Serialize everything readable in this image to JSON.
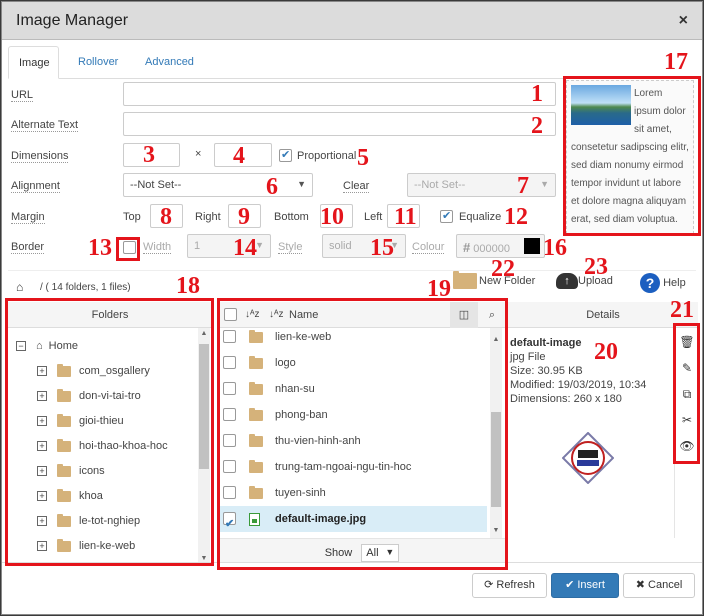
{
  "dialog": {
    "title": "Image Manager",
    "close_icon": "×"
  },
  "tabs": [
    {
      "label": "Image"
    },
    {
      "label": "Rollover"
    },
    {
      "label": "Advanced"
    }
  ],
  "form": {
    "url": {
      "label": "URL",
      "value": ""
    },
    "alt": {
      "label": "Alternate Text",
      "value": ""
    },
    "dimensions": {
      "label": "Dimensions",
      "width": "",
      "height": "",
      "separator": "×",
      "proportional_label": "Proportional",
      "proportional_checked": true
    },
    "alignment": {
      "label": "Alignment",
      "value": "--Not Set--"
    },
    "clear": {
      "label": "Clear",
      "value": "--Not Set--"
    },
    "margin": {
      "label": "Margin",
      "top_label": "Top",
      "right_label": "Right",
      "bottom_label": "Bottom",
      "left_label": "Left",
      "equalize_label": "Equalize",
      "equalize_checked": true
    },
    "border": {
      "label": "Border",
      "enabled": false,
      "width_label": "Width",
      "width_value": "1",
      "style_label": "Style",
      "style_value": "solid",
      "colour_label": "Colour",
      "colour_value": "000000",
      "colour_hash": "#",
      "colour_swatch": "#000000"
    }
  },
  "preview": {
    "text": "Lorem ipsum dolor sit amet, consetetur sadipscing elitr, sed diam nonumy eirmod tempor invidunt ut labore et dolore magna aliquyam erat, sed diam voluptua."
  },
  "browser": {
    "breadcrumb": "/ ( 14 folders, 1 files)",
    "new_folder_label": "New Folder",
    "upload_label": "Upload",
    "help_label": "Help",
    "folders_header": "Folders",
    "name_header": "Name",
    "details_header": "Details",
    "tree_root": "Home",
    "tree": [
      "com_osgallery",
      "don-vi-tai-tro",
      "gioi-thieu",
      "hoi-thao-khoa-hoc",
      "icons",
      "khoa",
      "le-tot-nghiep",
      "lien-ke-web"
    ],
    "files": [
      {
        "name": "lien-ke-web",
        "type": "folder",
        "selected": false
      },
      {
        "name": "logo",
        "type": "folder",
        "selected": false
      },
      {
        "name": "nhan-su",
        "type": "folder",
        "selected": false
      },
      {
        "name": "phong-ban",
        "type": "folder",
        "selected": false
      },
      {
        "name": "thu-vien-hinh-anh",
        "type": "folder",
        "selected": false
      },
      {
        "name": "trung-tam-ngoai-ngu-tin-hoc",
        "type": "folder",
        "selected": false
      },
      {
        "name": "tuyen-sinh",
        "type": "folder",
        "selected": false
      },
      {
        "name": "default-image.jpg",
        "type": "image",
        "selected": true
      }
    ],
    "show_label": "Show",
    "show_value": "All",
    "details": {
      "name": "default-image",
      "type": "jpg File",
      "size": "Size: 30.95 KB",
      "modified": "Modified: 19/03/2019, 10:34",
      "dimensions": "Dimensions: 260 x 180"
    },
    "actions": [
      "delete",
      "rename",
      "copy",
      "cut",
      "view"
    ]
  },
  "footer": {
    "refresh_label": "Refresh",
    "insert_label": "Insert",
    "cancel_label": "Cancel"
  },
  "annotations": [
    "1",
    "2",
    "3",
    "4",
    "5",
    "6",
    "7",
    "8",
    "9",
    "10",
    "11",
    "12",
    "13",
    "14",
    "15",
    "16",
    "17",
    "18",
    "19",
    "20",
    "21",
    "22",
    "23"
  ],
  "colors": {
    "accent": "#337ab7",
    "annotation": "#e4141b",
    "folder": "#d5b27a",
    "selected_row": "#d9edf7"
  }
}
